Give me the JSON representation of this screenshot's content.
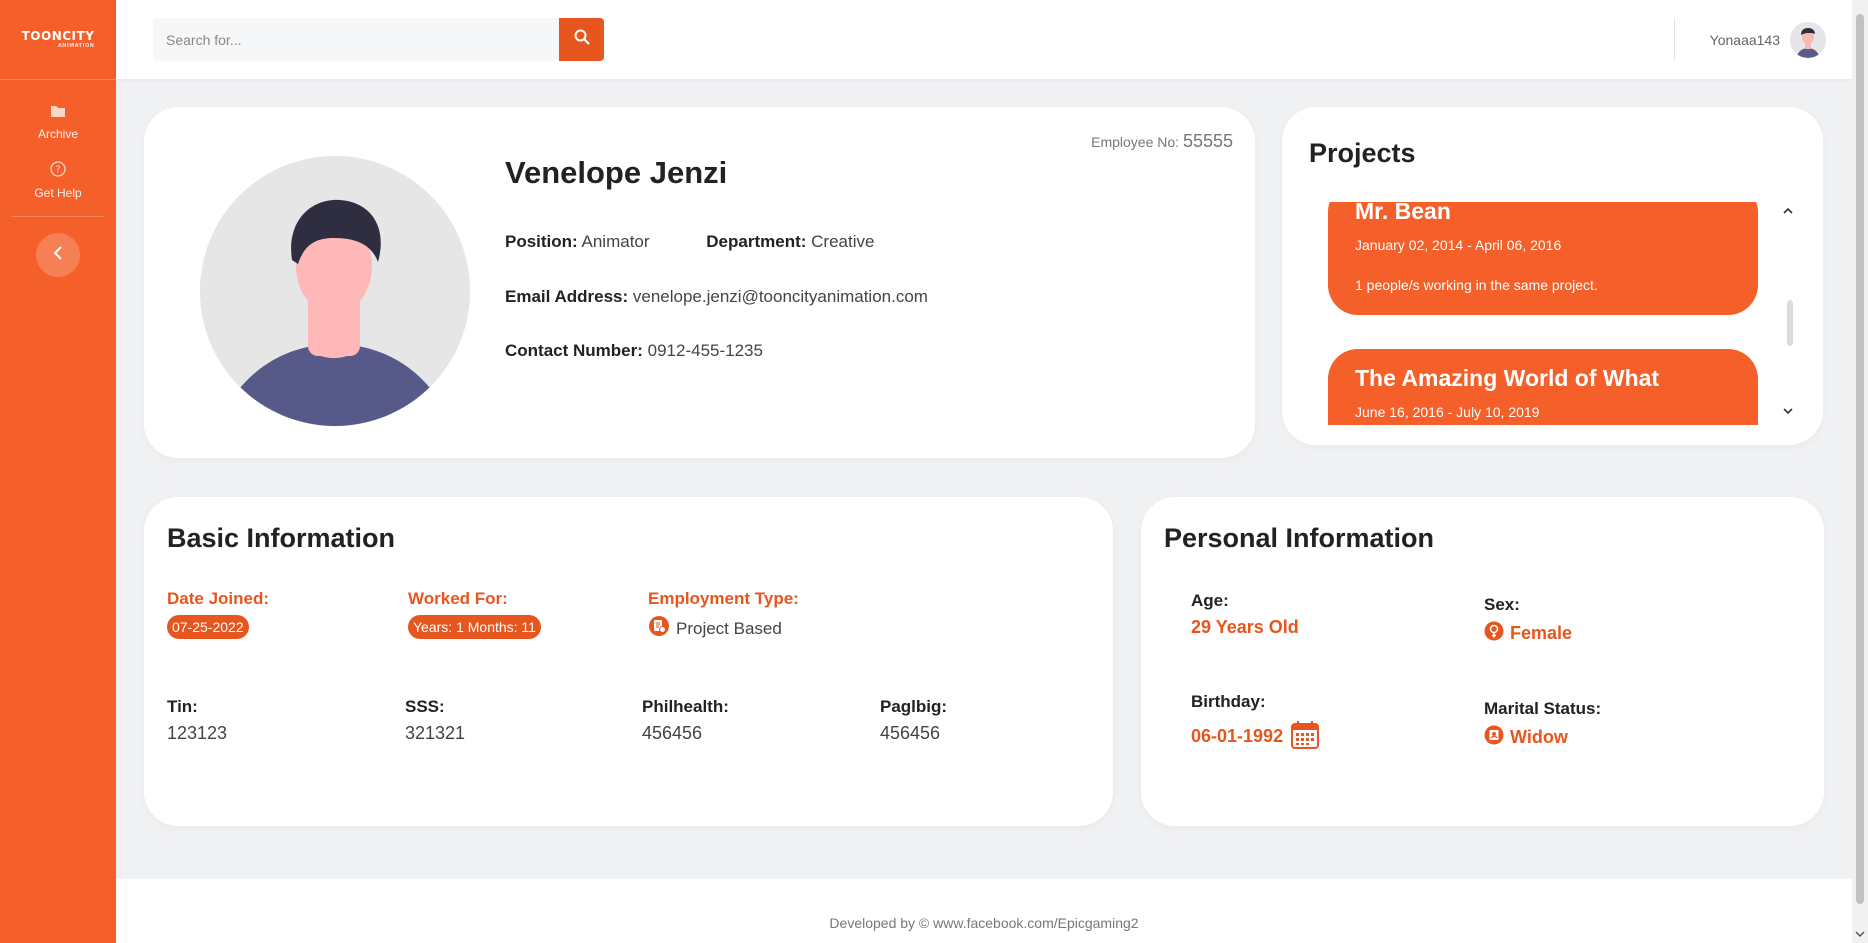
{
  "brand": {
    "logo_text": "TOONCITY",
    "logo_sub": "ANIMATION"
  },
  "sidebar": {
    "items": [
      {
        "label": "Archive",
        "icon": "folder-icon"
      },
      {
        "label": "Get Help",
        "icon": "help-icon"
      }
    ],
    "collapse_icon": "chevron-left-icon"
  },
  "search": {
    "placeholder": "Search for...",
    "value": ""
  },
  "user": {
    "name": "Yonaaa143"
  },
  "profile": {
    "employee_no_label": "Employee No:",
    "employee_no": "55555",
    "name": "Venelope Jenzi",
    "position_label": "Position:",
    "position": "Animator",
    "department_label": "Department:",
    "department": "Creative",
    "email_label": "Email Address:",
    "email": "venelope.jenzi@tooncityanimation.com",
    "contact_label": "Contact Number:",
    "contact": "0912-455-1235"
  },
  "projects": {
    "title": "Projects",
    "items": [
      {
        "title": "Mr. Bean",
        "dates": "January 02, 2014 - April 06, 2016",
        "people": "1 people/s working in the same project."
      },
      {
        "title": "The Amazing World of What",
        "dates": "June 16, 2016 - July 10, 2019"
      }
    ]
  },
  "basic": {
    "title": "Basic Information",
    "date_joined_label": "Date Joined:",
    "date_joined": "07-25-2022",
    "worked_for_label": "Worked For:",
    "worked_for": "Years: 1 Months: 11",
    "employment_type_label": "Employment Type:",
    "employment_type": "Project Based",
    "tin_label": "Tin:",
    "tin": "123123",
    "sss_label": "SSS:",
    "sss": "321321",
    "philhealth_label": "Philhealth:",
    "philhealth": "456456",
    "pagibig_label": "Paglbig:",
    "pagibig": "456456"
  },
  "personal": {
    "title": "Personal Information",
    "age_label": "Age:",
    "age": "29 Years Old",
    "sex_label": "Sex:",
    "sex": "Female",
    "birthday_label": "Birthday:",
    "birthday": "06-01-1992",
    "marital_label": "Marital Status:",
    "marital": "Widow"
  },
  "footer": {
    "text": "Developed by © www.facebook.com/Epicgaming2"
  },
  "colors": {
    "accent": "#f45f2a",
    "accent_dark": "#e8561f"
  }
}
